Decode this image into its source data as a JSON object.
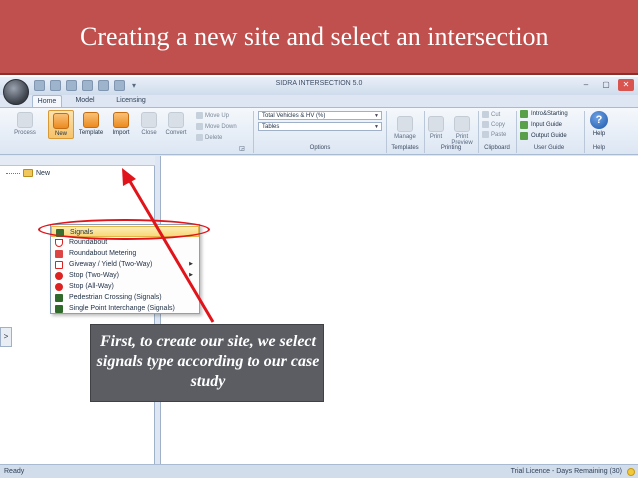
{
  "slide": {
    "title": "Creating a new site and select an intersection"
  },
  "window": {
    "title": "SIDRA INTERSECTION 5.0",
    "tabs": [
      "Home",
      "Model",
      "Licensing"
    ],
    "active_tab": "Home"
  },
  "ribbon": {
    "buttons": {
      "process": "Process",
      "new": "New",
      "template": "Template",
      "import": "Import",
      "close": "Close",
      "convert": "Convert",
      "move_up": "Move Up",
      "move_down": "Move Down",
      "delete": "Delete",
      "manage": "Manage",
      "print": "Print",
      "print_preview": "Print Preview",
      "cut": "Cut",
      "copy": "Copy",
      "paste": "Paste",
      "help": "Help"
    },
    "options_combo": "Total Vehicles & HV (%)",
    "tables_combo": "Tables",
    "guides": [
      "Intro&Starting",
      "Input Guide",
      "Output Guide"
    ],
    "group_labels": {
      "options": "Options",
      "templates": "Templates",
      "printing": "Printing",
      "clipboard": "Clipboard",
      "user_guide": "User Guide",
      "help": "Help"
    }
  },
  "tree": {
    "item": "New"
  },
  "menu": {
    "items": [
      {
        "label": "Signals",
        "icon": "traffic-signal-icon",
        "selected": true
      },
      {
        "label": "Roundabout",
        "icon": "roundabout-icon"
      },
      {
        "label": "Roundabout Metering",
        "icon": "roundabout-metering-icon"
      },
      {
        "label": "Giveway / Yield (Two-Way)",
        "icon": "giveway-icon",
        "submenu": true
      },
      {
        "label": "Stop (Two-Way)",
        "icon": "stop-icon",
        "submenu": true
      },
      {
        "label": "Stop (All-Way)",
        "icon": "stop-icon"
      },
      {
        "label": "Pedestrian Crossing (Signals)",
        "icon": "pedestrian-icon"
      },
      {
        "label": "Single Point Interchange (Signals)",
        "icon": "interchange-icon"
      }
    ]
  },
  "status": {
    "left": "Ready",
    "right": "Trial Licence - Days Remaining (30)"
  },
  "callout": {
    "text": "First, to create our site, we select signals type according to our case study"
  },
  "colors": {
    "banner": "#c0504d",
    "annotation_red": "#e0141a",
    "callout_bg": "#5b5d63"
  }
}
